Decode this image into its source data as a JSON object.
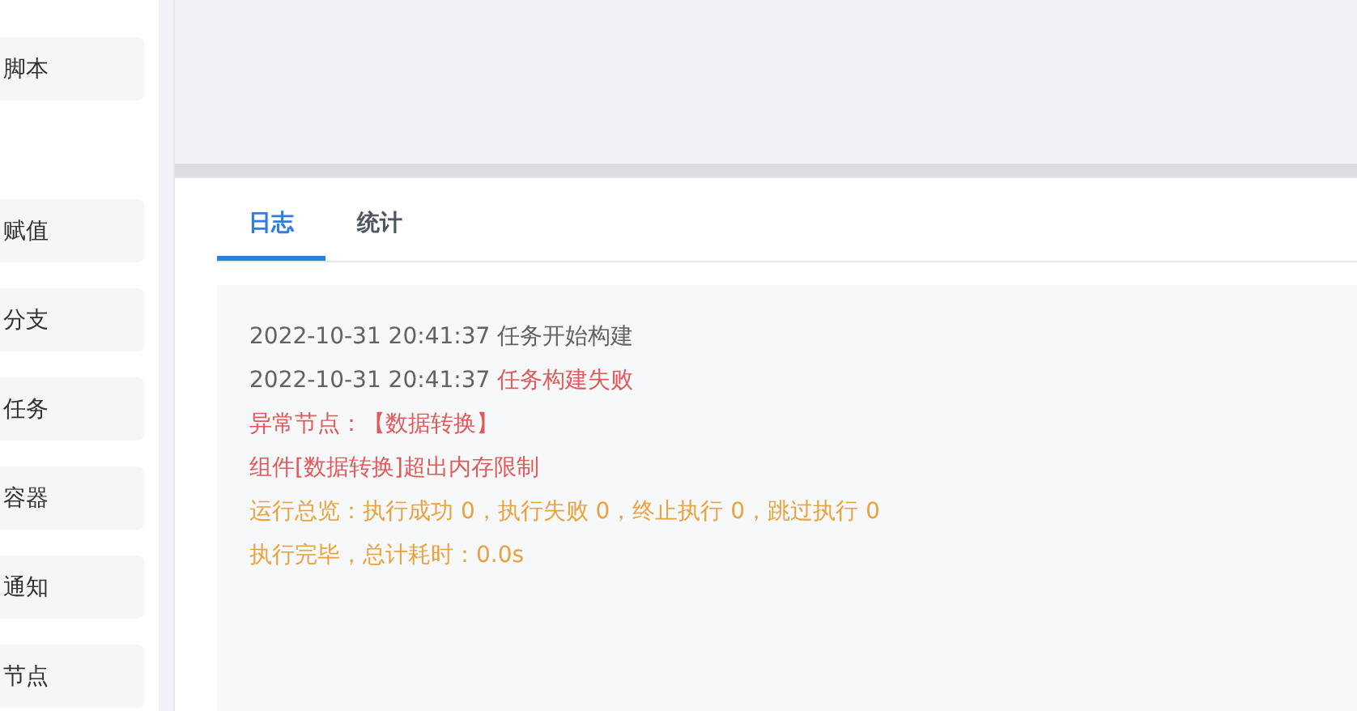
{
  "sidebar": {
    "items": [
      {
        "label": "脚本"
      },
      {
        "label": "赋值"
      },
      {
        "label": "分支"
      },
      {
        "label": "任务"
      },
      {
        "label": "容器"
      },
      {
        "label": "通知"
      },
      {
        "label": "节点"
      }
    ]
  },
  "tabs": [
    {
      "label": "日志",
      "selected": true
    },
    {
      "label": "统计",
      "selected": false
    }
  ],
  "log": {
    "lines": [
      {
        "time": "2022-10-31 20:41:37",
        "text": "任务开始构建",
        "kind": "info"
      },
      {
        "time": "2022-10-31 20:41:37",
        "text": "任务构建失败",
        "kind": "error"
      },
      {
        "text": "异常节点：【数据转换】",
        "kind": "error"
      },
      {
        "text": "组件[数据转换]超出内存限制",
        "kind": "error"
      },
      {
        "text": "运行总览：执行成功 0，执行失败 0，终止执行 0，跳过执行 0",
        "kind": "warning"
      },
      {
        "text": "执行完毕，总计耗时：0.0s",
        "kind": "warning"
      }
    ]
  }
}
